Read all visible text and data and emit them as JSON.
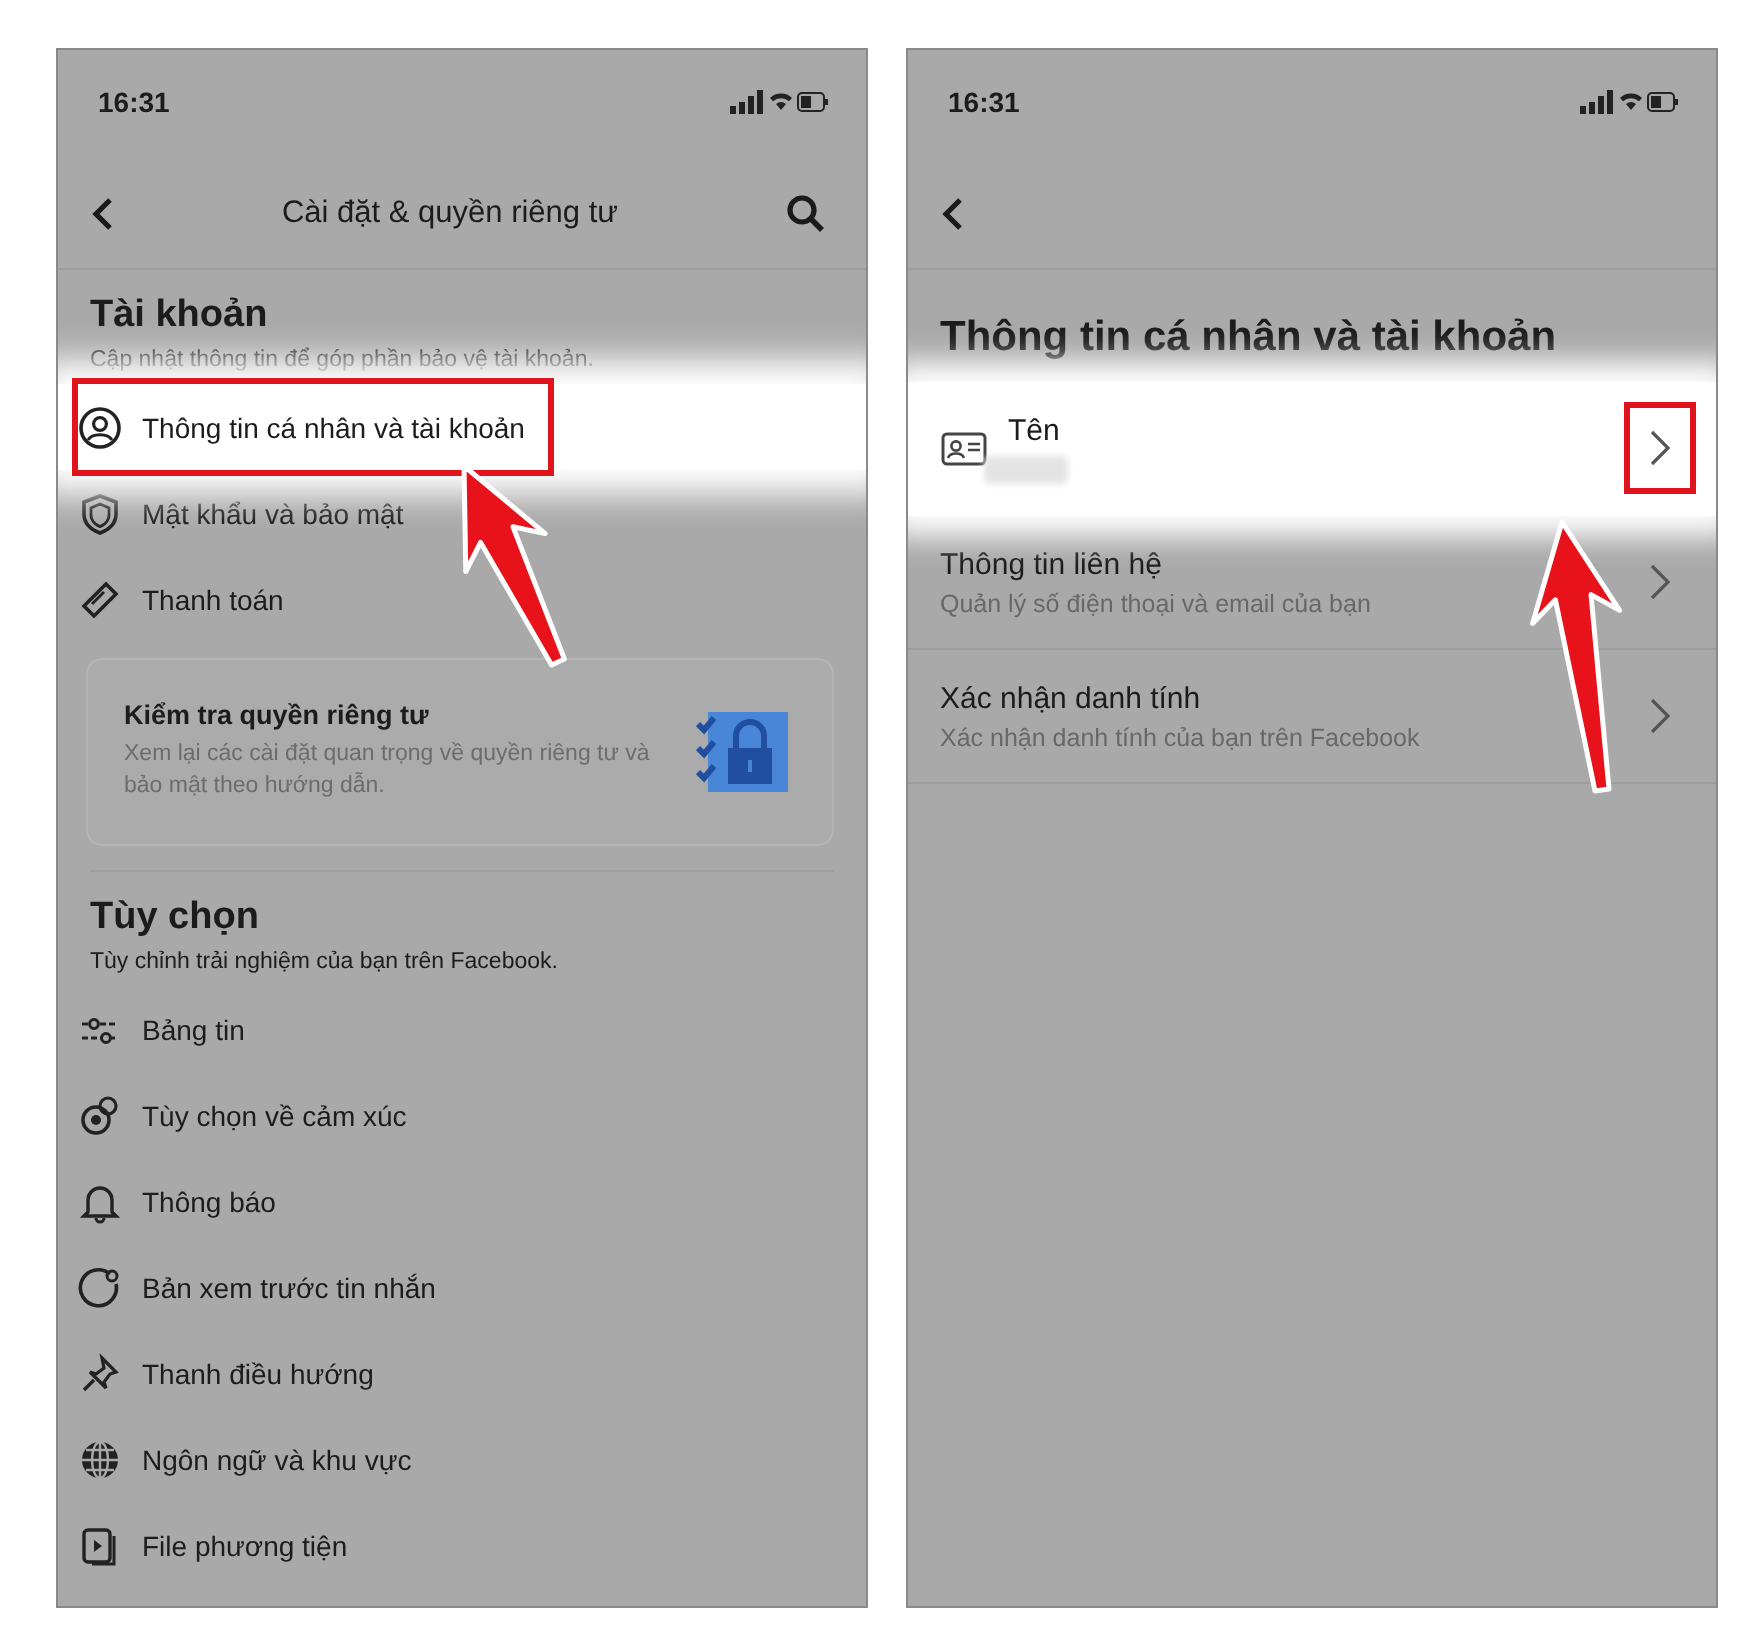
{
  "panels": [
    {
      "status_time": "16:31",
      "header_title": "Cài đặt & quyền riêng tư",
      "sections": [
        {
          "title": "Tài khoản",
          "subtitle": "Cập nhật thông tin để góp phần bảo vệ tài khoản.",
          "items": [
            {
              "label": "Thông tin cá nhân và tài khoản",
              "spotlight": true,
              "red_box": true
            },
            {
              "label": "Mật khẩu và bảo mật",
              "spotlight": false,
              "red_box": false
            },
            {
              "label": "Thanh toán",
              "spotlight": false,
              "red_box": false
            }
          ],
          "card": {
            "title": "Kiểm tra quyền riêng tư",
            "text": "Xem lại các cài đặt quan trọng về quyền riêng tư và bảo mật theo hướng dẫn."
          }
        },
        {
          "title": "Tùy chọn",
          "subtitle": "Tùy chỉnh trải nghiệm của bạn trên Facebook.",
          "items": [
            {
              "label": "Bảng tin",
              "spotlight": false,
              "red_box": false
            },
            {
              "label": "Tùy chọn về cảm xúc",
              "spotlight": false,
              "red_box": false
            },
            {
              "label": "Thông báo",
              "spotlight": false,
              "red_box": false
            },
            {
              "label": "Bản xem trước tin nhắn",
              "spotlight": false,
              "red_box": false
            },
            {
              "label": "Thanh điều hướng",
              "spotlight": false,
              "red_box": false
            },
            {
              "label": "Ngôn ngữ và khu vực",
              "spotlight": false,
              "red_box": false
            },
            {
              "label": "File phương tiện",
              "spotlight": false,
              "red_box": false
            }
          ]
        }
      ]
    },
    {
      "status_time": "16:31",
      "page_title": "Thông tin cá nhân và tài khoản",
      "rows": [
        {
          "label": "Tên",
          "value_hidden": true,
          "spotlight": true,
          "red_box": true
        },
        {
          "label": "Thông tin liên hệ",
          "sublabel": "Quản lý số điện thoại và email của bạn",
          "value_hidden": false,
          "spotlight": false,
          "red_box": false
        },
        {
          "label": "Xác nhận danh tính",
          "sublabel": "Xác nhận danh tính của bạn trên Facebook",
          "value_hidden": false,
          "spotlight": false,
          "red_box": false
        }
      ]
    }
  ]
}
